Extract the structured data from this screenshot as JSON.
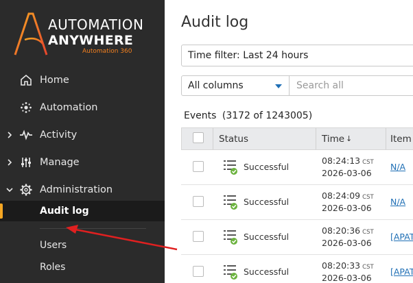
{
  "brand": {
    "line1": "AUTOMATION",
    "line2": "ANYWHERE",
    "line3": "Automation 360",
    "accent_color": "#f4801f"
  },
  "sidebar": {
    "items": [
      {
        "label": "Home",
        "icon": "home-icon",
        "expandable": false
      },
      {
        "label": "Automation",
        "icon": "automation-icon",
        "expandable": false
      },
      {
        "label": "Activity",
        "icon": "activity-icon",
        "expandable": true,
        "expanded": false
      },
      {
        "label": "Manage",
        "icon": "manage-icon",
        "expandable": true,
        "expanded": false
      },
      {
        "label": "Administration",
        "icon": "gear-icon",
        "expandable": true,
        "expanded": true
      }
    ],
    "sub_items": [
      {
        "label": "Audit log",
        "active": true
      },
      {
        "label": "Users",
        "active": false
      },
      {
        "label": "Roles",
        "active": false
      }
    ],
    "active_color": "#f5a623"
  },
  "main": {
    "title": "Audit log",
    "time_filter": "Time filter: Last 24 hours",
    "column_select": "All columns",
    "search_placeholder": "Search all",
    "events_label": "Events",
    "events_count": "(3172 of 1243005)",
    "columns": [
      "Status",
      "Time",
      "Item n"
    ],
    "sort_indicator": "↓",
    "rows": [
      {
        "status": "Successful",
        "time": "08:24:13",
        "tz": "CST",
        "date": "2026-03-06",
        "item": "N/A"
      },
      {
        "status": "Successful",
        "time": "08:24:09",
        "tz": "CST",
        "date": "2026-03-06",
        "item": "N/A"
      },
      {
        "status": "Successful",
        "time": "08:20:36",
        "tz": "CST",
        "date": "2026-03-06",
        "item": "[APATO"
      },
      {
        "status": "Successful",
        "time": "08:20:33",
        "tz": "CST",
        "date": "2026-03-06",
        "item": "[APATO"
      }
    ]
  },
  "annotation": {
    "color": "#e02020"
  }
}
